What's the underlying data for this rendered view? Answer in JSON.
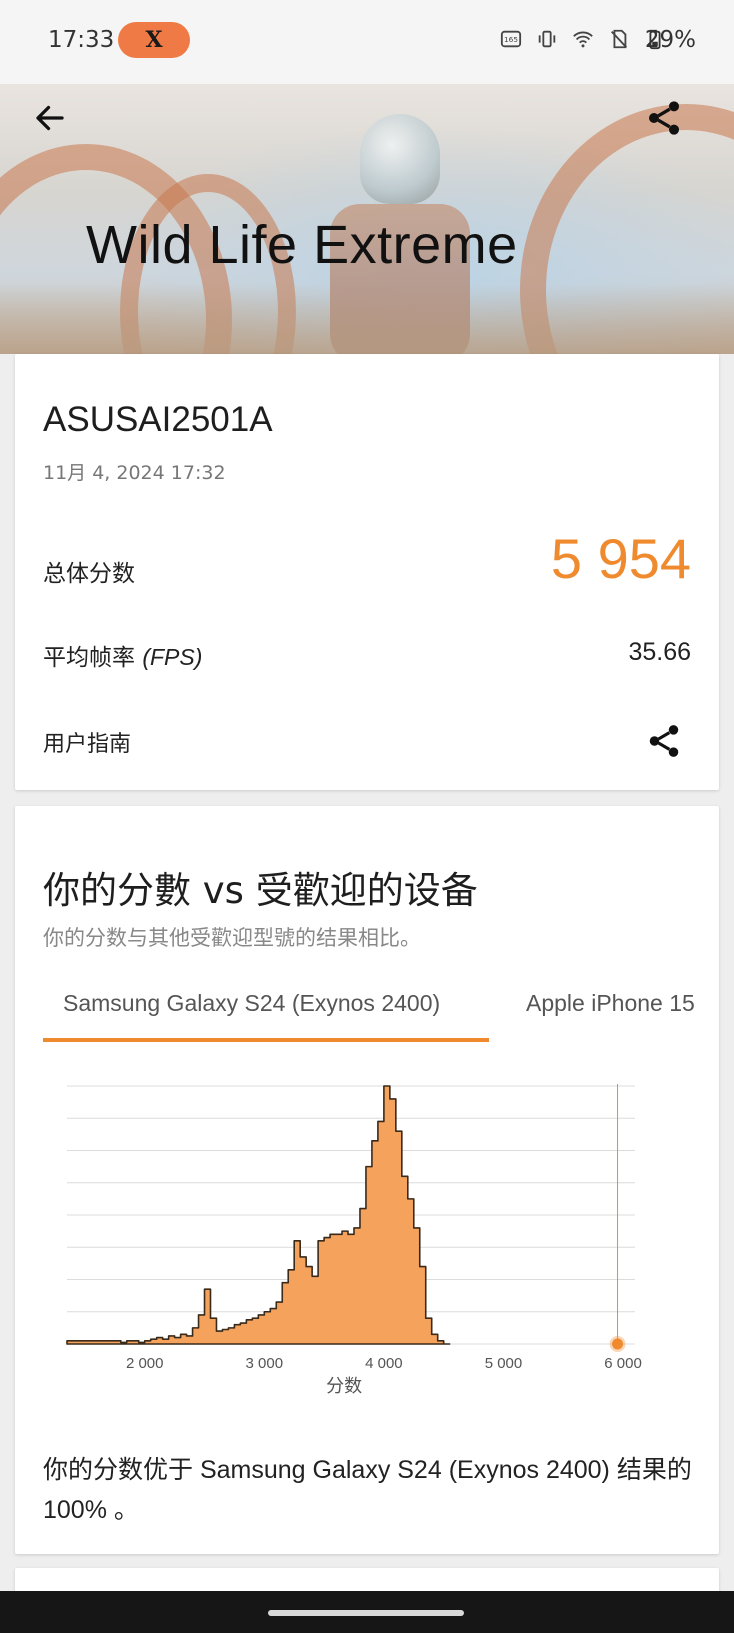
{
  "status_bar": {
    "time": "17:33",
    "pill_label": "X",
    "battery_text": "29%",
    "icons": [
      "refresh-rate-165hz-icon",
      "vibrate-icon",
      "wifi-6-icon",
      "no-sim-icon",
      "battery-icon"
    ]
  },
  "header": {
    "title": "Wild Life Extreme",
    "back_icon": "arrow-left-icon",
    "share_icon": "share-icon"
  },
  "result_card": {
    "device_name": "ASUSAI2501A",
    "date": "11月 4, 2024 17:32",
    "overall_score_label": "总体分数",
    "overall_score": "5 954",
    "avg_fps_label": "平均帧率",
    "avg_fps_unit": "(FPS)",
    "avg_fps": "35.66",
    "user_guide_label": "用户指南",
    "accent_color": "#ef8a2e"
  },
  "comparison": {
    "title": "你的分數 vs 受歡迎的设备",
    "subtitle": "你的分数与其他受歡迎型號的结果相比。",
    "tabs": [
      {
        "label": "Samsung Galaxy S24 (Exynos 2400)",
        "active": true
      },
      {
        "label": "Apple iPhone 15",
        "active": false
      }
    ],
    "result_text": "你的分数优于 Samsung Galaxy S24 (Exynos 2400) 结果的 100% 。"
  },
  "chart_data": {
    "type": "area",
    "title": "",
    "xlabel": "分数",
    "ylabel": "",
    "xlim": [
      1350,
      6100
    ],
    "ylim": [
      0,
      8
    ],
    "x_ticks": [
      2000,
      3000,
      4000,
      5000,
      6000
    ],
    "x_tick_labels": [
      "2 000",
      "3 000",
      "4 000",
      "5 000",
      "6 000"
    ],
    "grid": "horizontal",
    "fill_color": "#f5a25d",
    "user_score": 5954,
    "marker_color": "#ef8a2e",
    "series": [
      {
        "x": [
          1350,
          1800,
          1800,
          1850,
          1850,
          1950,
          1950,
          2000,
          2000,
          2050,
          2050,
          2100,
          2100,
          2150,
          2150,
          2200,
          2200,
          2250,
          2250,
          2300,
          2300,
          2350,
          2350,
          2400,
          2400,
          2450,
          2450,
          2500,
          2500,
          2550,
          2550,
          2600,
          2600,
          2650,
          2650,
          2700,
          2700,
          2750,
          2750,
          2800,
          2800,
          2850,
          2850,
          2900,
          2900,
          2950,
          2950,
          3000,
          3000,
          3050,
          3050,
          3100,
          3100,
          3150,
          3150,
          3200,
          3200,
          3250,
          3250,
          3300,
          3300,
          3350,
          3350,
          3400,
          3400,
          3450,
          3450,
          3500,
          3500,
          3550,
          3550,
          3600,
          3600,
          3650,
          3650,
          3700,
          3700,
          3750,
          3750,
          3800,
          3800,
          3850,
          3850,
          3900,
          3900,
          3950,
          3950,
          4000,
          4000,
          4050,
          4050,
          4100,
          4100,
          4150,
          4150,
          4200,
          4200,
          4250,
          4250,
          4300,
          4300,
          4350,
          4350,
          4400,
          4400,
          4450,
          4450,
          4500,
          4500,
          4550
        ],
        "y": [
          0.1,
          0.1,
          0.05,
          0.05,
          0.1,
          0.1,
          0.05,
          0.05,
          0.1,
          0.1,
          0.15,
          0.15,
          0.2,
          0.2,
          0.15,
          0.15,
          0.25,
          0.25,
          0.2,
          0.2,
          0.3,
          0.3,
          0.25,
          0.25,
          0.5,
          0.5,
          0.9,
          0.9,
          1.7,
          1.7,
          0.8,
          0.8,
          0.4,
          0.4,
          0.45,
          0.45,
          0.5,
          0.5,
          0.6,
          0.6,
          0.65,
          0.65,
          0.75,
          0.75,
          0.8,
          0.8,
          0.9,
          0.9,
          1.0,
          1.0,
          1.1,
          1.1,
          1.3,
          1.3,
          1.9,
          1.9,
          2.3,
          2.3,
          3.2,
          3.2,
          2.7,
          2.7,
          2.4,
          2.4,
          2.1,
          2.1,
          3.2,
          3.2,
          3.3,
          3.3,
          3.4,
          3.4,
          3.4,
          3.4,
          3.5,
          3.5,
          3.4,
          3.4,
          3.6,
          3.6,
          4.2,
          4.2,
          5.5,
          5.5,
          6.3,
          6.3,
          6.9,
          6.9,
          8.0,
          8.0,
          7.6,
          7.6,
          6.6,
          6.6,
          5.2,
          5.2,
          4.5,
          4.5,
          3.6,
          3.6,
          2.4,
          2.4,
          0.8,
          0.8,
          0.3,
          0.3,
          0.1,
          0.1,
          0.0,
          0.0
        ]
      }
    ]
  }
}
